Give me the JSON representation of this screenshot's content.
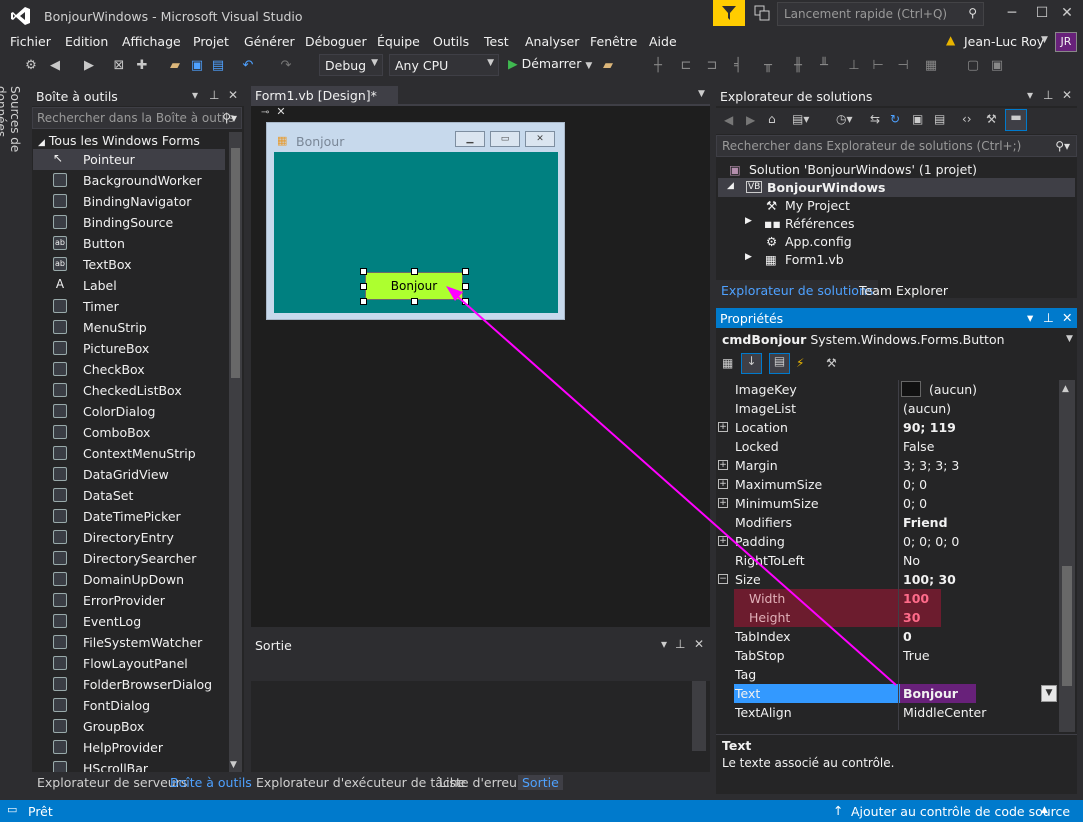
{
  "window": {
    "title": "BonjourWindows - Microsoft Visual Studio",
    "quick_launch": "Lancement rapide (Ctrl+Q)"
  },
  "menu": [
    "Fichier",
    "Edition",
    "Affichage",
    "Projet",
    "Générer",
    "Déboguer",
    "Équipe",
    "Outils",
    "Test",
    "Analyser",
    "Fenêtre",
    "Aide"
  ],
  "user": {
    "name": "Jean-Luc Roy",
    "initials": "JR"
  },
  "toolbar": {
    "config": "Debug",
    "platform": "Any CPU",
    "start_label": "Démarrer"
  },
  "left_strip": {
    "label": "Sources de données"
  },
  "toolbox": {
    "title": "Boîte à outils",
    "search_placeholder": "Rechercher dans la Boîte à outils",
    "group": "Tous les Windows Forms",
    "items": [
      "Pointeur",
      "BackgroundWorker",
      "BindingNavigator",
      "BindingSource",
      "Button",
      "TextBox",
      "Label",
      "Timer",
      "MenuStrip",
      "PictureBox",
      "CheckBox",
      "CheckedListBox",
      "ColorDialog",
      "ComboBox",
      "ContextMenuStrip",
      "DataGridView",
      "DataSet",
      "DateTimePicker",
      "DirectoryEntry",
      "DirectorySearcher",
      "DomainUpDown",
      "ErrorProvider",
      "EventLog",
      "FileSystemWatcher",
      "FlowLayoutPanel",
      "FolderBrowserDialog",
      "FontDialog",
      "GroupBox",
      "HelpProvider",
      "HScrollBar"
    ],
    "icon_letters": {
      "Button": "ab",
      "TextBox": "ab",
      "Label": "A"
    },
    "tabs": [
      "Explorateur de serveurs",
      "Boîte à outils"
    ]
  },
  "designer": {
    "tab": "Form1.vb [Design]*",
    "form_title": "Bonjour",
    "form_back_color": "#008080",
    "button_text": "Bonjour",
    "button_color": "#adff2f"
  },
  "output": {
    "title": "Sortie",
    "tabs": [
      "Explorateur d'exécuteur de tâche",
      "Liste d'erreurs",
      "Sortie"
    ]
  },
  "solution": {
    "title": "Explorateur de solutions",
    "search_placeholder": "Rechercher dans Explorateur de solutions (Ctrl+;)",
    "nodes": [
      "Solution 'BonjourWindows' (1 projet)",
      "BonjourWindows",
      "My Project",
      "Références",
      "App.config",
      "Form1.vb"
    ],
    "tabs": [
      "Explorateur de solutions",
      "Team Explorer"
    ]
  },
  "properties": {
    "title": "Propriétés",
    "object": "cmdBonjour",
    "object_type": "System.Windows.Forms.Button",
    "rows": [
      {
        "name": "ImageKey",
        "value": "(aucun)"
      },
      {
        "name": "ImageList",
        "value": "(aucun)"
      },
      {
        "name": "Location",
        "value": "90; 119"
      },
      {
        "name": "Locked",
        "value": "False"
      },
      {
        "name": "Margin",
        "value": "3; 3; 3; 3"
      },
      {
        "name": "MaximumSize",
        "value": "0; 0"
      },
      {
        "name": "MinimumSize",
        "value": "0; 0"
      },
      {
        "name": "Modifiers",
        "value": "Friend"
      },
      {
        "name": "Padding",
        "value": "0; 0; 0; 0"
      },
      {
        "name": "RightToLeft",
        "value": "No"
      },
      {
        "name": "Size",
        "value": "100; 30"
      },
      {
        "name": "Width",
        "value": "100"
      },
      {
        "name": "Height",
        "value": "30"
      },
      {
        "name": "TabIndex",
        "value": "0"
      },
      {
        "name": "TabStop",
        "value": "True"
      },
      {
        "name": "Tag",
        "value": ""
      },
      {
        "name": "Text",
        "value": "Bonjour"
      },
      {
        "name": "TextAlign",
        "value": "MiddleCenter"
      }
    ],
    "desc_title": "Text",
    "desc_text": "Le texte associé au contrôle."
  },
  "status": {
    "left": "Prêt",
    "right": "Ajouter au contrôle de code source"
  },
  "colors": {
    "accent": "#007acc",
    "highlight_row": "#6c1c2e",
    "arrow": "#ff00ff"
  }
}
